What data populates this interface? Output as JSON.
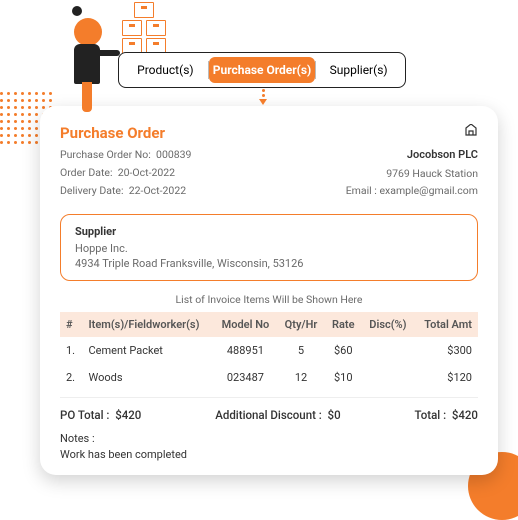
{
  "tabs": {
    "products": "Product(s)",
    "purchase_orders": "Purchase Order(s)",
    "suppliers": "Supplier(s)"
  },
  "po": {
    "title": "Purchase Order",
    "no_label": "Purchase Order No:",
    "no_value": "000839",
    "order_date_label": "Order Date:",
    "order_date_value": "20-Oct-2022",
    "delivery_date_label": "Delivery Date:",
    "delivery_date_value": "22-Oct-2022"
  },
  "company": {
    "name": "Jocobson PLC",
    "address": "9769 Hauck Station",
    "email_label": "Email :",
    "email": "example@gmail.com"
  },
  "supplier": {
    "title": "Supplier",
    "name": "Hoppe Inc.",
    "address": "4934 Triple Road Franksville, Wisconsin, 53126"
  },
  "invoice_note": "List of Invoice Items Will be Shown Here",
  "columns": {
    "idx": "#",
    "item": "Item(s)/Fieldworker(s)",
    "model": "Model No",
    "qty": "Qty/Hr",
    "rate": "Rate",
    "disc": "Disc(%)",
    "total": "Total Amt"
  },
  "rows": [
    {
      "idx": "1.",
      "item": "Cement Packet",
      "model": "488951",
      "qty": "5",
      "rate": "$60",
      "disc": "",
      "total": "$300"
    },
    {
      "idx": "2.",
      "item": "Woods",
      "model": "023487",
      "qty": "12",
      "rate": "$10",
      "disc": "",
      "total": "$120"
    }
  ],
  "totals": {
    "po_total_label": "PO Total :",
    "po_total_value": "$420",
    "addl_disc_label": "Additional Discount :",
    "addl_disc_value": "$0",
    "grand_label": "Total :",
    "grand_value": "$420"
  },
  "notes": {
    "label": "Notes :",
    "body": "Work has been completed"
  }
}
